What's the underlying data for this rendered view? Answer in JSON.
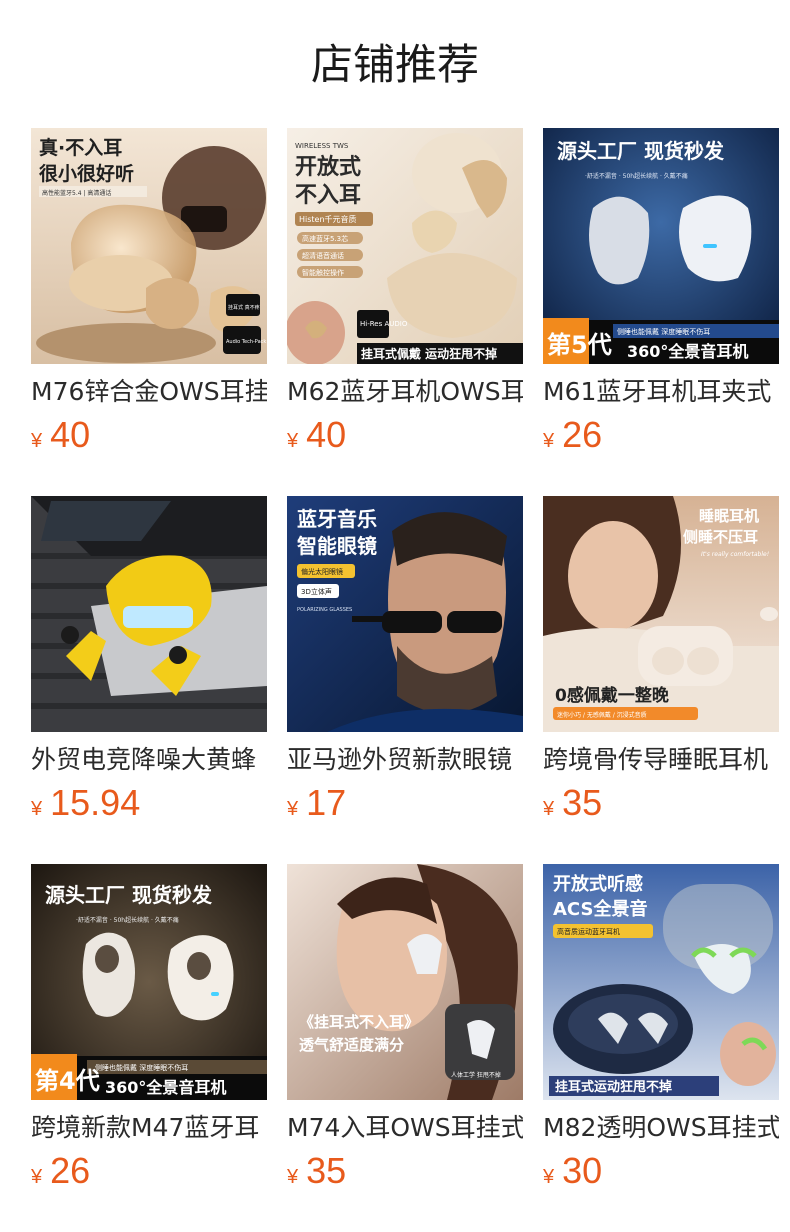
{
  "section_title": "店铺推荐",
  "currency_symbol": "¥",
  "products": [
    {
      "name": "M76锌合金OWS耳挂",
      "price": "40",
      "image_text": [
        "真·不入耳",
        "很小很好听",
        "高性能蓝牙5.4 | 高清通话",
        "挂耳式 真不疼",
        "Audio Tech-Pack"
      ]
    },
    {
      "name": "M62蓝牙耳机OWS耳",
      "price": "40",
      "image_text": [
        "WIRELESS TWS",
        "开放式",
        "不入耳",
        "Histen千元音质",
        "高速蓝牙5.3芯",
        "超清语音通话",
        "智能触控操作",
        "Hi-Res AUDIO",
        "挂耳式佩戴 运动狂甩不掉"
      ]
    },
    {
      "name": "M61蓝牙耳机耳夹式",
      "price": "26",
      "image_text": [
        "源头工厂 现货秒发",
        "·舒适不漏音 · 50h超长续航 · 久戴不痛",
        "第5代",
        "侧睡也能佩戴 深度睡眠不伤耳",
        "360°全景音耳机"
      ]
    },
    {
      "name": "外贸电竞降噪大黄蜂",
      "price": "15.94",
      "image_text": []
    },
    {
      "name": "亚马逊外贸新款眼镜",
      "price": "17",
      "image_text": [
        "蓝牙音乐",
        "智能眼镜",
        "偏光太阳眼镜",
        "3D立体声",
        "POLARIZING GLASSES"
      ]
    },
    {
      "name": "跨境骨传导睡眠耳机",
      "price": "35",
      "image_text": [
        "睡眠耳机",
        "侧睡不压耳",
        "It's really comfortable!",
        "0感佩戴一整晚",
        "迷你小巧 / 无感佩戴 / 沉浸式音质"
      ]
    },
    {
      "name": "跨境新款M47蓝牙耳",
      "price": "26",
      "image_text": [
        "源头工厂 现货秒发",
        "·舒适不漏音 · 50h超长续航 · 久戴不痛",
        "第4代",
        "侧睡也能佩戴 深度睡眠不伤耳",
        "360°全景音耳机"
      ]
    },
    {
      "name": "M74入耳OWS耳挂式",
      "price": "35",
      "image_text": [
        "《挂耳式不入耳》",
        "透气舒适度满分",
        "人体工学 狂甩不掉"
      ]
    },
    {
      "name": "M82透明OWS耳挂式",
      "price": "30",
      "image_text": [
        "开放式听感",
        "ACS全景音",
        "高音质运动蓝牙耳机",
        "挂耳式运动狂甩不掉"
      ]
    }
  ]
}
